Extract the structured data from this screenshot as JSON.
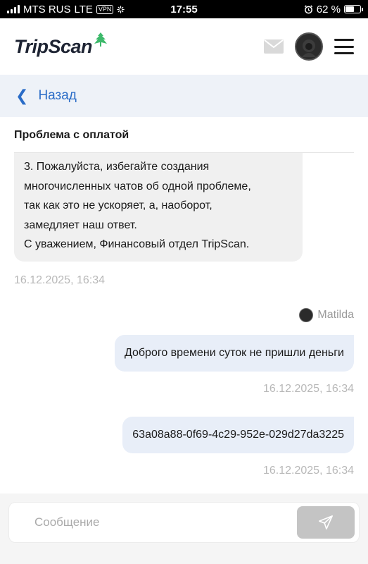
{
  "status_bar": {
    "carrier": "MTS RUS",
    "network": "LTE",
    "vpn": "VPN",
    "time": "17:55",
    "battery_percent": "62 %",
    "battery_level": 0.62
  },
  "header": {
    "logo_text": "TripScan",
    "logo_accent_color": "#3db96b"
  },
  "back": {
    "label": "Назад",
    "color": "#2a6cc7"
  },
  "chat": {
    "title": "Проблема с оплатой",
    "incoming": {
      "lines": [
        "3. Пожалуйста, избегайте создания",
        "многочисленных чатов об одной проблеме,",
        "так как это не ускоряет, а, наоборот,",
        "замедляет наш ответ.",
        "С уважением, Финансовый отдел TripScan."
      ],
      "time": "16.12.2025, 16:34"
    },
    "sender_name": "Matilda",
    "outgoing": [
      {
        "text": "Доброго времени суток не пришли деньги",
        "time": "16.12.2025, 16:34"
      },
      {
        "text": "63a08a88-0f69-4c29-952e-029d27da3225",
        "time": "16.12.2025, 16:34"
      }
    ]
  },
  "composer": {
    "placeholder": "Сообщение"
  },
  "icons": {
    "mail": "mail-icon",
    "send": "send-icon",
    "menu": "menu-icon",
    "back": "chevron-left-icon",
    "logo": "tree-icon"
  }
}
